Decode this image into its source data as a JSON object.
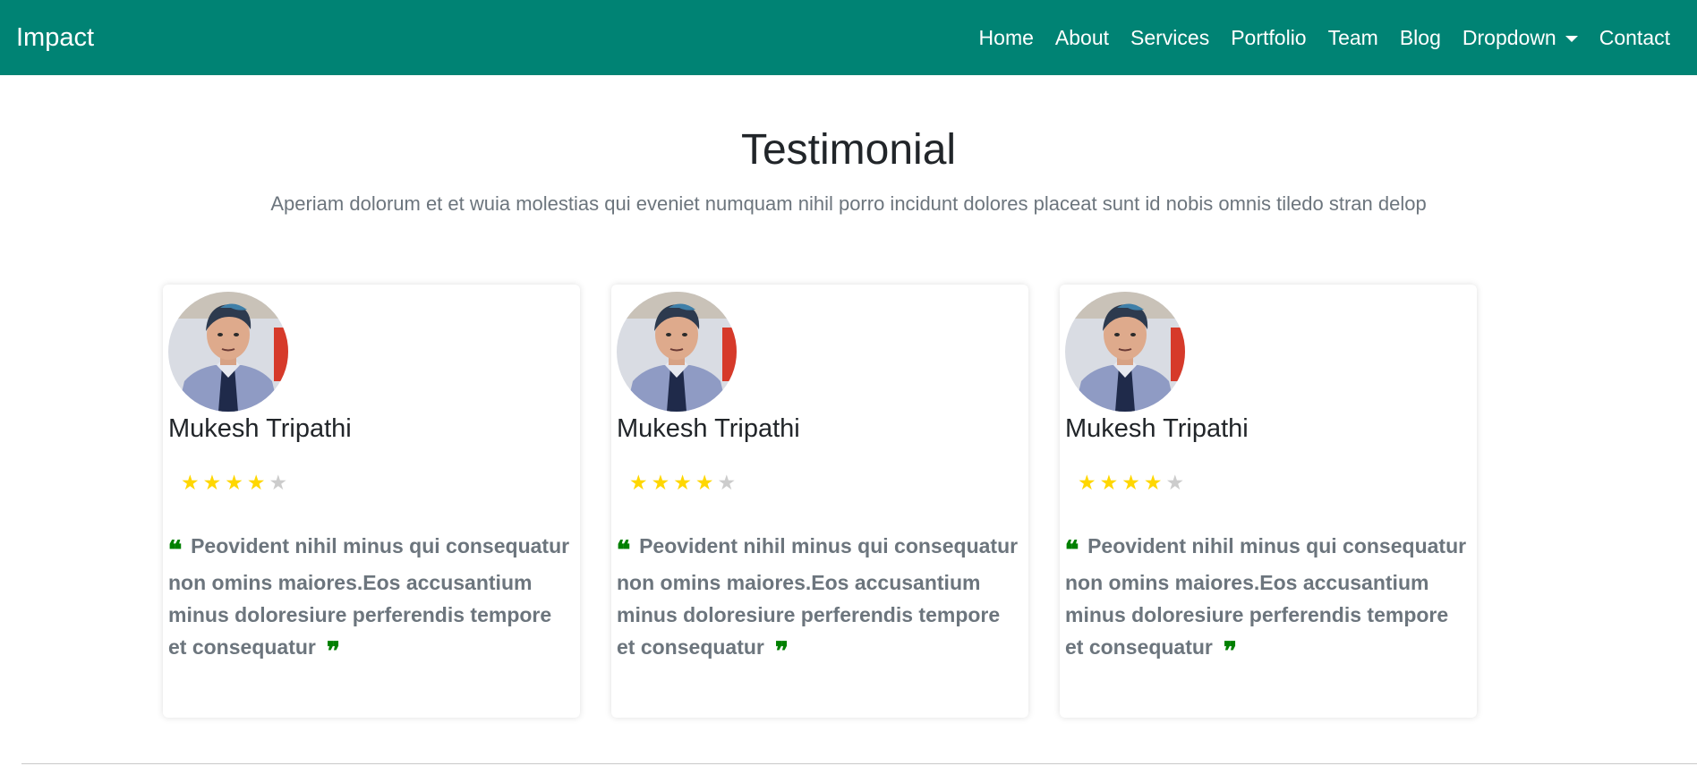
{
  "header": {
    "brand": "Impact",
    "nav": [
      {
        "label": "Home"
      },
      {
        "label": "About"
      },
      {
        "label": "Services"
      },
      {
        "label": "Portfolio"
      },
      {
        "label": "Team"
      },
      {
        "label": "Blog"
      },
      {
        "label": "Dropdown"
      },
      {
        "label": "Contact"
      }
    ]
  },
  "section": {
    "title": "Testimonial",
    "subtitle": "Aperiam dolorum et et wuia molestias qui eveniet numquam nihil porro incidunt dolores placeat sunt id nobis omnis tiledo stran delop"
  },
  "testimonials": [
    {
      "name": "Mukesh Tripathi",
      "rating": 4,
      "max_rating": 5,
      "quote": "Peovident nihil minus qui consequatur non omins maiores.Eos accusantium minus doloresiure perferendis tempore et consequatur"
    },
    {
      "name": "Mukesh Tripathi",
      "rating": 4,
      "max_rating": 5,
      "quote": "Peovident nihil minus qui consequatur non omins maiores.Eos accusantium minus doloresiure perferendis tempore et consequatur"
    },
    {
      "name": "Mukesh Tripathi",
      "rating": 4,
      "max_rating": 5,
      "quote": "Peovident nihil minus qui consequatur non omins maiores.Eos accusantium minus doloresiure perferendis tempore et consequatur"
    }
  ],
  "colors": {
    "navbar": "#008374",
    "star_filled": "#ffd700",
    "star_empty": "#cccccc",
    "quote_icon": "#008000"
  }
}
